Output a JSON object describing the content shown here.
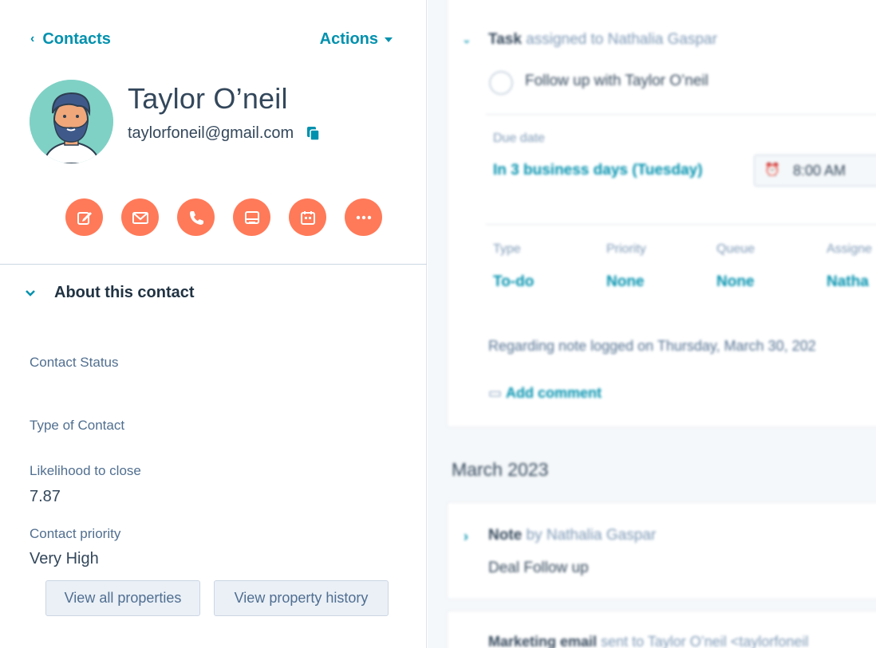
{
  "nav": {
    "back_label": "Contacts",
    "actions_label": "Actions"
  },
  "contact": {
    "name": "Taylor O’neil",
    "email": "taylorfoneil@gmail.com"
  },
  "quick_actions": [
    "note",
    "email",
    "call",
    "log",
    "meeting",
    "more"
  ],
  "about": {
    "title": "About this contact",
    "properties": [
      {
        "label": "Contact Status",
        "value": ""
      },
      {
        "label": "Type of Contact",
        "value": ""
      },
      {
        "label": "Likelihood to close",
        "value": "7.87"
      },
      {
        "label": "Contact priority",
        "value": "Very High"
      }
    ],
    "buttons": {
      "view_all": "View all properties",
      "history": "View property history"
    }
  },
  "timeline": {
    "task": {
      "type_word": "Task",
      "assigned_text": "assigned to Nathalia Gaspar",
      "title": "Follow up with Taylor O’neil",
      "due_label": "Due date",
      "due_value": "In 3 business days (Tuesday)",
      "time_value": "8:00 AM",
      "fields": [
        {
          "label": "Type",
          "value": "To-do"
        },
        {
          "label": "Priority",
          "value": "None"
        },
        {
          "label": "Queue",
          "value": "None"
        },
        {
          "label": "Assigne",
          "value": "Natha"
        }
      ],
      "regarding": "Regarding note logged on Thursday, March 30, 202",
      "add_comment": "Add comment"
    },
    "month_header": "March 2023",
    "note": {
      "type_word": "Note",
      "by_text": "by Nathalia Gaspar",
      "body": "Deal Follow up"
    },
    "marketing": {
      "type_word": "Marketing email",
      "sent_text": "sent to Taylor O’neil <taylorfoneil"
    }
  },
  "colors": {
    "accent": "#0091ae",
    "action_orange": "#ff7a59",
    "text": "#33475b",
    "label": "#516f90",
    "button_bg": "#eaf0f6",
    "avatar_bg": "#7fd1c5"
  },
  "icons": [
    "chevron-left-icon",
    "caret-down-icon",
    "copy-icon",
    "edit-icon",
    "email-icon",
    "phone-icon",
    "log-icon",
    "calendar-icon",
    "more-icon",
    "chevron-down-icon"
  ]
}
